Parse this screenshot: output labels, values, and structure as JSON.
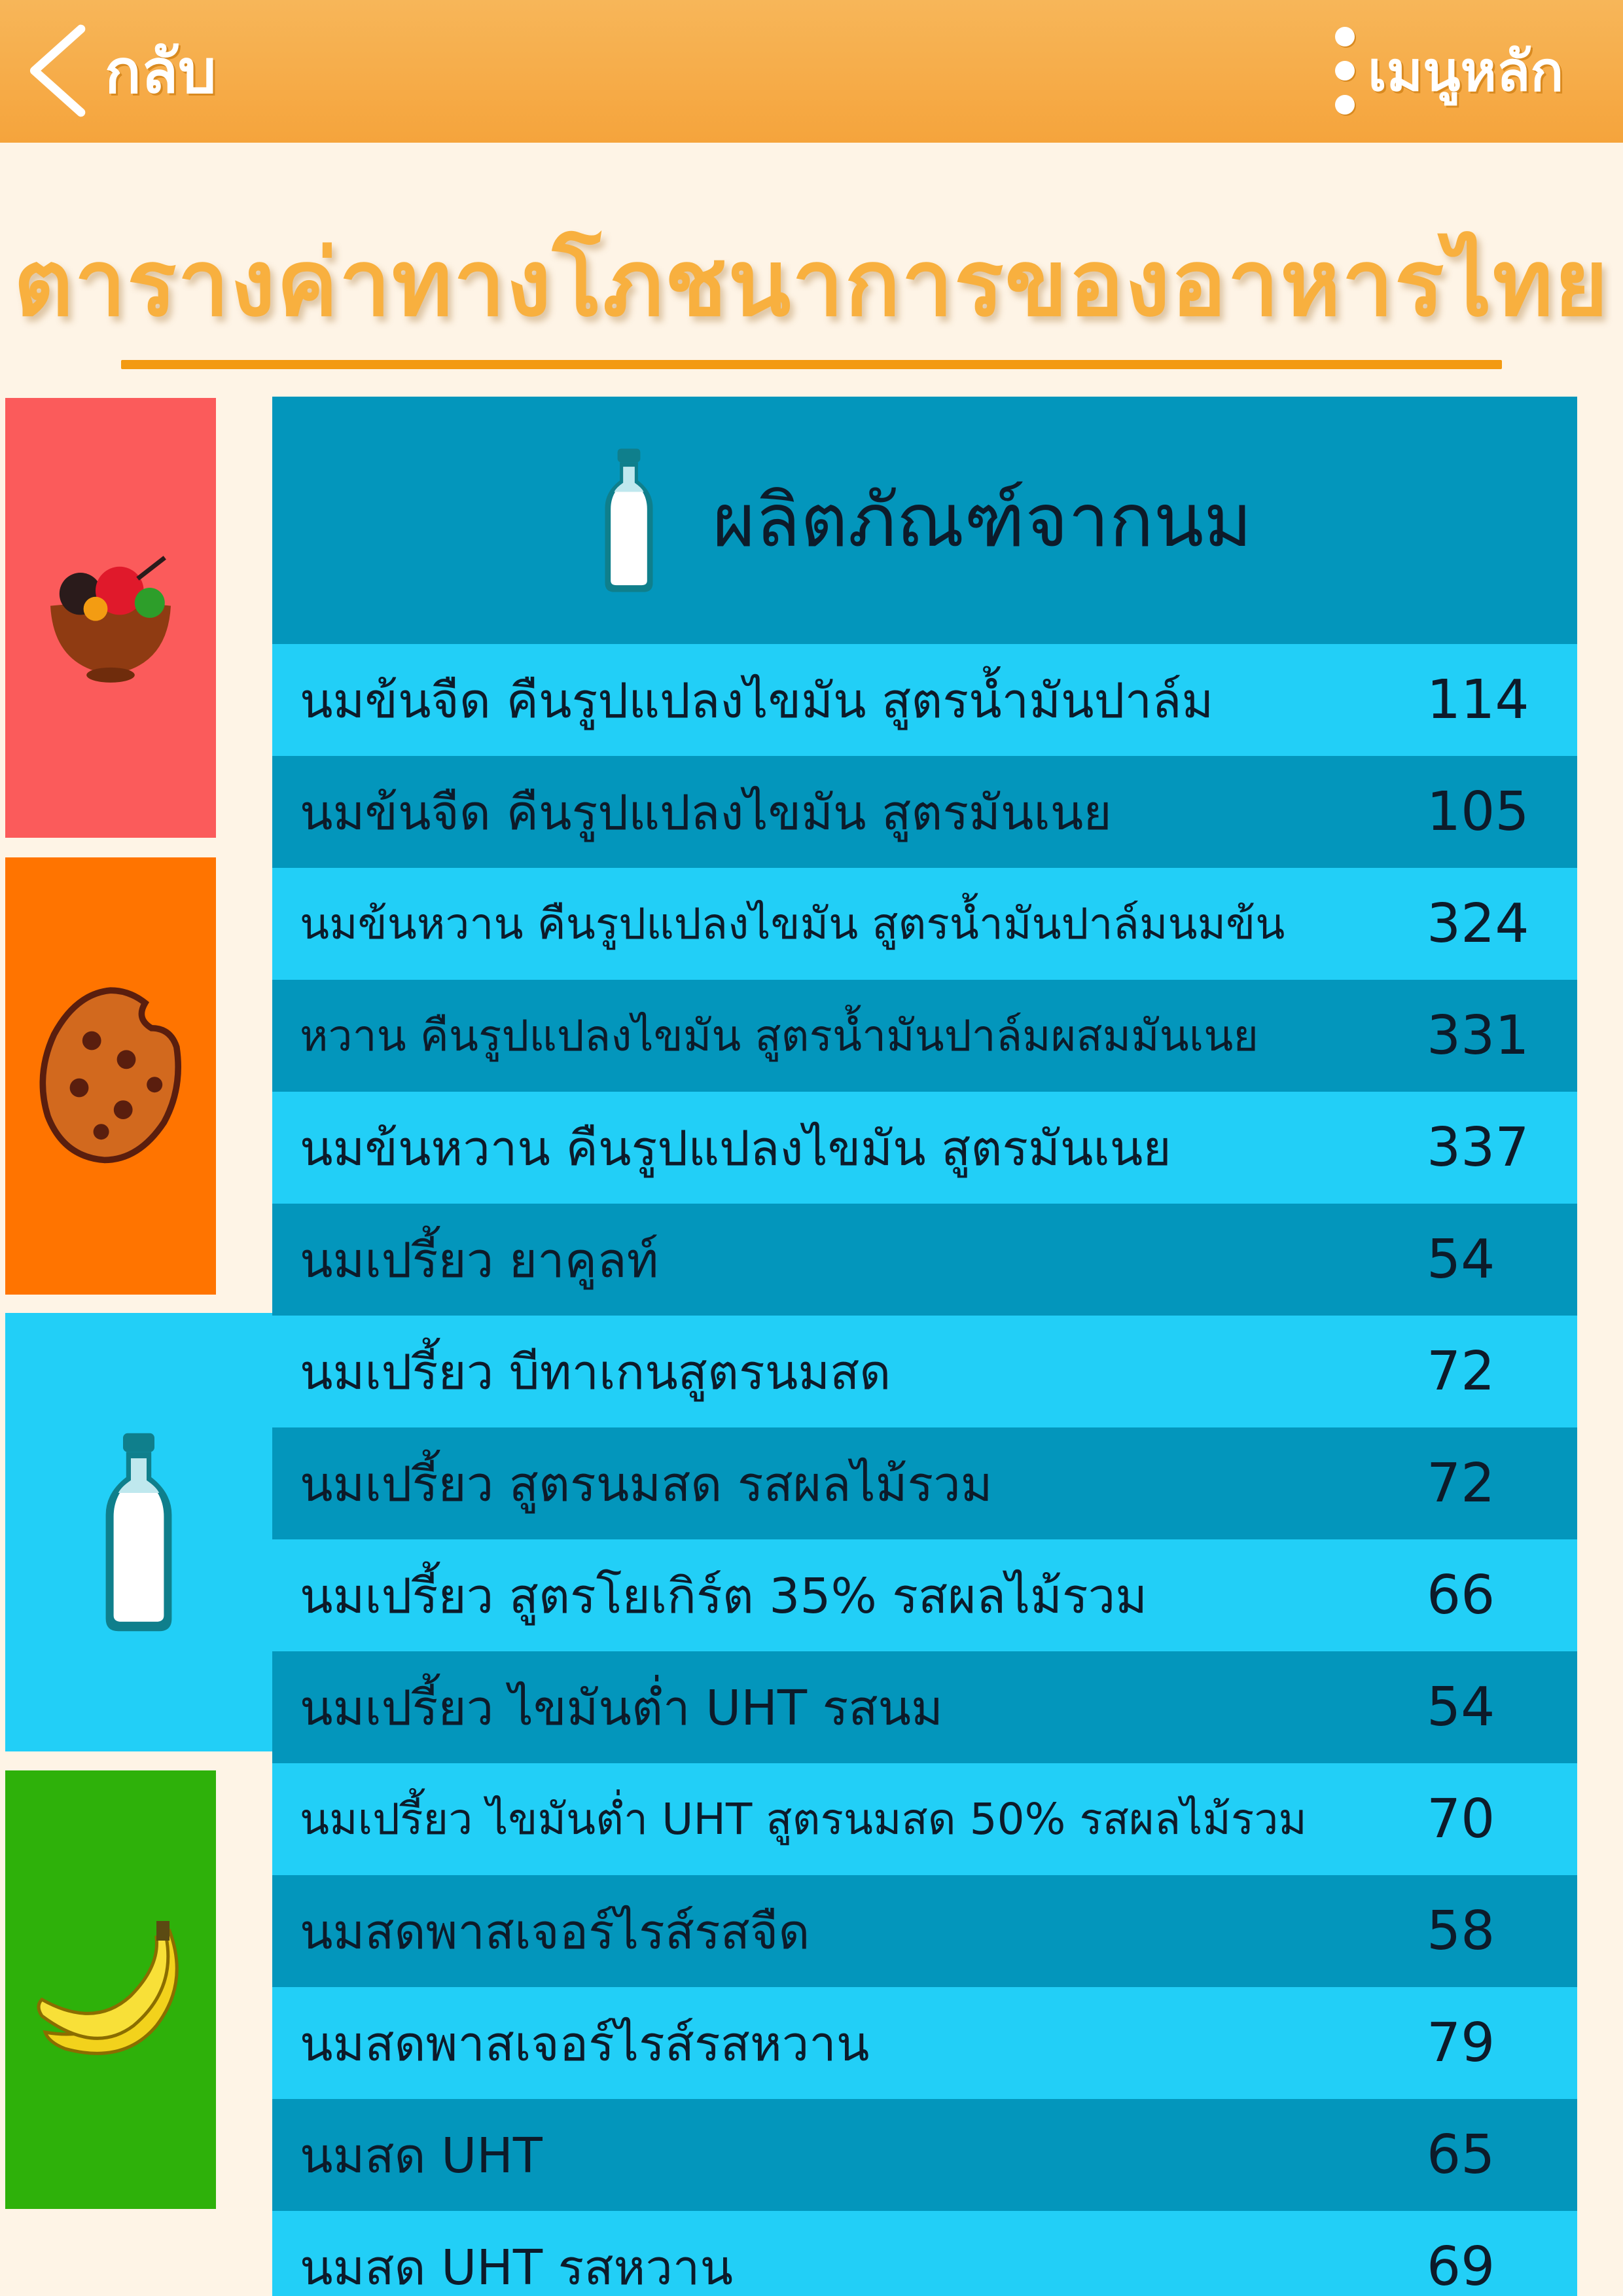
{
  "header": {
    "back_label": "กลับ",
    "menu_label": "เมนูหลัก",
    "back_icon": "chevron-left-icon",
    "menu_icon": "vertical-dots-icon"
  },
  "page_title": "ตารางค่าทางโภชนาการของอาหารไทย",
  "categories": [
    {
      "icon": "dessert-bowl-icon",
      "color": "#fb5b5b"
    },
    {
      "icon": "cookie-icon",
      "color": "#ff7400"
    },
    {
      "icon": "milk-bottle-icon",
      "color": "#22cff7",
      "selected": true
    },
    {
      "icon": "banana-icon",
      "color": "#2eb10a"
    }
  ],
  "panel": {
    "icon": "milk-bottle-icon",
    "title": "ผลิตภัณฑ์จากนม",
    "rows": [
      {
        "name": "นมข้นจืด คืนรูปแปลงไขมัน สูตรน้ำมันปาล์ม",
        "value": "114"
      },
      {
        "name": "นมข้นจืด คืนรูปแปลงไขมัน สูตรมันเนย",
        "value": "105"
      },
      {
        "name": "นมข้นหวาน คืนรูปแปลงไขมัน สูตรน้ำมันปาล์มนมข้น",
        "value": "324"
      },
      {
        "name": "หวาน คืนรูปแปลงไขมัน สูตรน้ำมันปาล์มผสมมันเนย",
        "value": "331"
      },
      {
        "name": "นมข้นหวาน คืนรูปแปลงไขมัน สูตรมันเนย",
        "value": "337"
      },
      {
        "name": "นมเปรี้ยว ยาคูลท์",
        "value": "54"
      },
      {
        "name": "นมเปรี้ยว บีทาเกนสูตรนมสด",
        "value": "72"
      },
      {
        "name": "นมเปรี้ยว สูตรนมสด รสผลไม้รวม",
        "value": "72"
      },
      {
        "name": "นมเปรี้ยว สูตรโยเกิร์ต 35% รสผลไม้รวม",
        "value": "66"
      },
      {
        "name": "นมเปรี้ยว ไขมันต่ำ UHT รสนม",
        "value": "54"
      },
      {
        "name": "นมเปรี้ยว ไขมันต่ำ UHT สูตรนมสด 50% รสผลไม้รวม",
        "value": "70"
      },
      {
        "name": "นมสดพาสเจอร์ไรส์รสจืด",
        "value": "58"
      },
      {
        "name": "นมสดพาสเจอร์ไรส์รสหวาน",
        "value": "79"
      },
      {
        "name": "นมสด UHT",
        "value": "65"
      },
      {
        "name": "นมสด UHT รสหวาน",
        "value": "69"
      }
    ]
  }
}
